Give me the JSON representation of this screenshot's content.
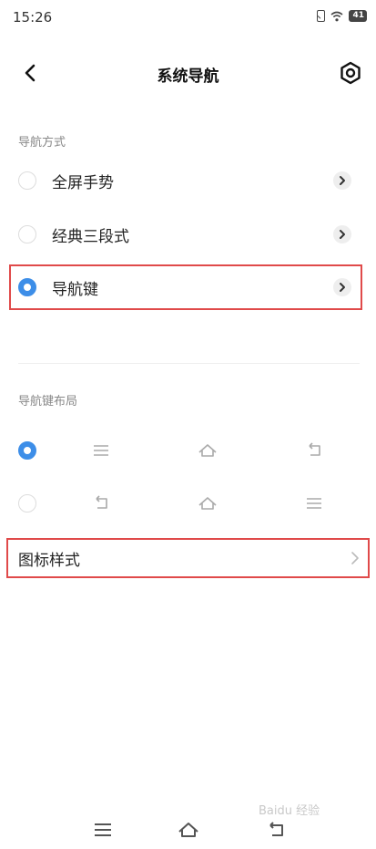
{
  "status_bar": {
    "time": "15:26",
    "battery": "41",
    "icons": [
      "sim-icon",
      "wifi-icon",
      "battery-icon"
    ]
  },
  "header": {
    "title": "系统导航",
    "back_icon": "back-arrow-icon",
    "settings_icon": "settings-icon"
  },
  "nav_mode_section": {
    "label": "导航方式",
    "options": [
      {
        "label": "全屏手势",
        "selected": false
      },
      {
        "label": "经典三段式",
        "selected": false
      },
      {
        "label": "导航键",
        "selected": true
      }
    ]
  },
  "nav_layout_section": {
    "label": "导航键布局",
    "options": [
      {
        "selected": true,
        "icons": [
          "menu-icon",
          "home-icon",
          "back-icon"
        ]
      },
      {
        "selected": false,
        "icons": [
          "back-icon",
          "home-icon",
          "menu-icon"
        ]
      }
    ]
  },
  "icon_style": {
    "label": "图标样式"
  },
  "bottom_nav": {
    "icons": [
      "menu-icon",
      "home-icon",
      "back-icon"
    ]
  },
  "watermark": "Baidu 经验",
  "colors": {
    "accent": "#3d8ee8",
    "highlight": "#e04a4a"
  }
}
